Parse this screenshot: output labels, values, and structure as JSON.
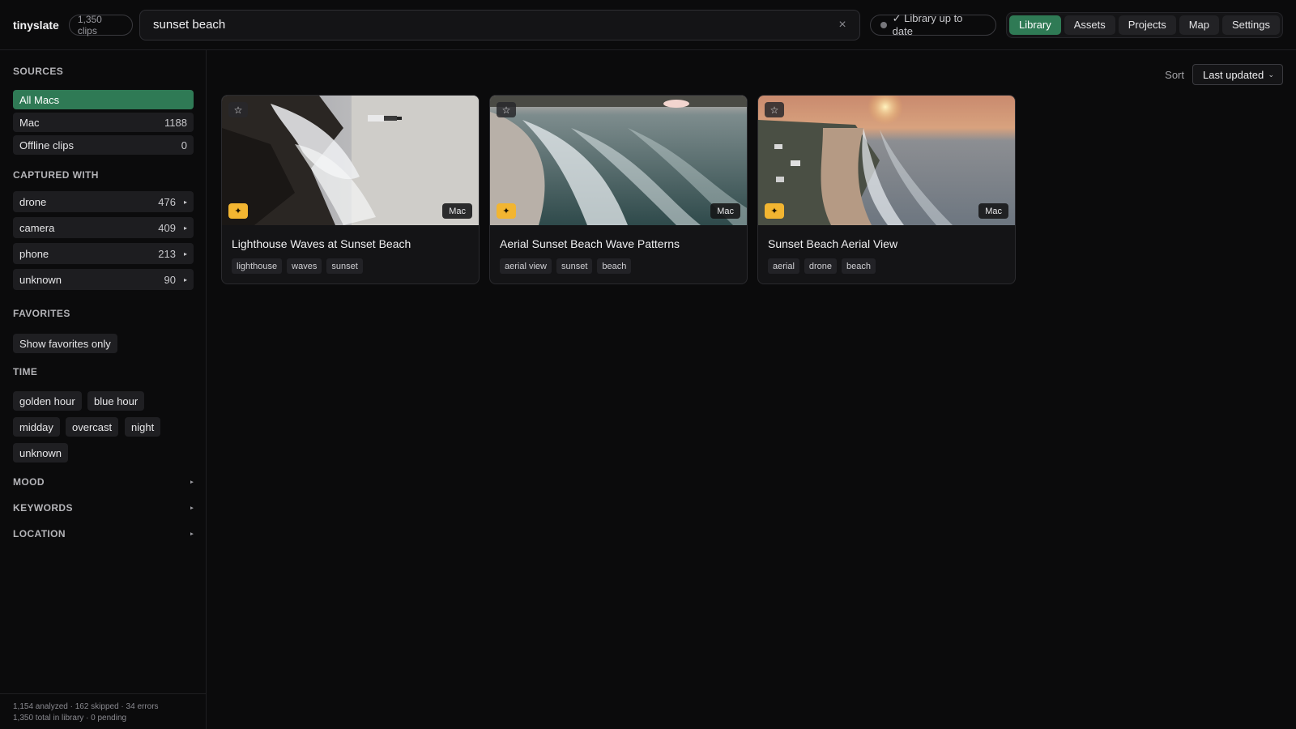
{
  "header": {
    "brand": "tinyslate",
    "clip_count": "1,350 clips",
    "search_value": "sunset beach",
    "status": "✓ Library up to date",
    "nav": [
      {
        "label": "Library",
        "active": true
      },
      {
        "label": "Assets",
        "active": false
      },
      {
        "label": "Projects",
        "active": false
      },
      {
        "label": "Map",
        "active": false
      },
      {
        "label": "Settings",
        "active": false
      }
    ]
  },
  "sidebar": {
    "sources_title": "SOURCES",
    "sources": [
      {
        "label": "All Macs",
        "count": "",
        "active": true
      },
      {
        "label": "Mac",
        "count": "1188"
      },
      {
        "label": "Offline clips",
        "count": "0"
      }
    ],
    "captured_title": "CAPTURED WITH",
    "captured": [
      {
        "label": "drone",
        "count": "476"
      },
      {
        "label": "camera",
        "count": "409"
      },
      {
        "label": "phone",
        "count": "213"
      },
      {
        "label": "unknown",
        "count": "90"
      }
    ],
    "favorites_title": "FAVORITES",
    "favorites_button": "Show favorites only",
    "time_title": "TIME",
    "time_chips": [
      "golden hour",
      "blue hour",
      "midday",
      "overcast",
      "night",
      "unknown"
    ],
    "mood_title": "MOOD",
    "keywords_title": "KEYWORDS",
    "location_title": "LOCATION",
    "stats_line1": "1,154 analyzed · 162 skipped · 34 errors",
    "stats_line2": "1,350 total in library · 0 pending"
  },
  "main": {
    "sort_label": "Sort",
    "sort_value": "Last updated",
    "cards": [
      {
        "title": "Lighthouse Waves at Sunset Beach",
        "source": "Mac",
        "tags": [
          "lighthouse",
          "waves",
          "sunset"
        ]
      },
      {
        "title": "Aerial Sunset Beach Wave Patterns",
        "source": "Mac",
        "tags": [
          "aerial view",
          "sunset",
          "beach"
        ]
      },
      {
        "title": "Sunset Beach Aerial View",
        "source": "Mac",
        "tags": [
          "aerial",
          "drone",
          "beach"
        ]
      }
    ]
  },
  "icons": {
    "star": "☆",
    "sparkle": "✦",
    "close": "×",
    "chevron": "⌄",
    "triangle": "▸"
  }
}
